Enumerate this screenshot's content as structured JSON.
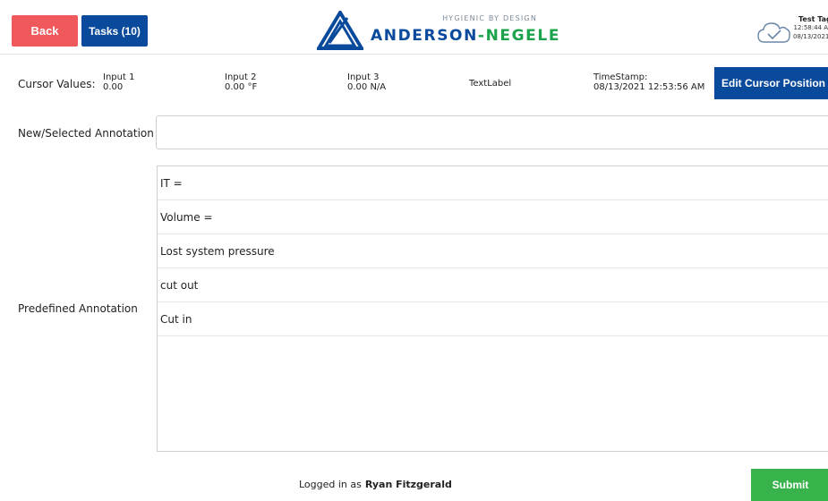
{
  "header": {
    "back_label": "Back",
    "tasks_label": "Tasks (10)",
    "logo_tagline": "HYGIENIC BY DESIGN",
    "logo_name_part1": "ANDERSON",
    "logo_name_sep": "-",
    "logo_name_part2": "NEGELE",
    "tag": {
      "title": "Test Tag",
      "time": "12:58:44 A",
      "date": "08/13/2021"
    }
  },
  "cursor": {
    "label": "Cursor Values:",
    "inputs": [
      {
        "name": "Input 1",
        "value": "0.00"
      },
      {
        "name": "Input 2",
        "value": "0.00 °F"
      },
      {
        "name": "Input 3",
        "value": "0.00 N/A"
      }
    ],
    "text_label": "TextLabel",
    "timestamp_label": "TimeStamp:",
    "timestamp_value": "08/13/2021 12:53:56 AM",
    "edit_button": "Edit Cursor Position"
  },
  "new_annotation": {
    "label": "New/Selected Annotation",
    "value": ""
  },
  "predefined": {
    "label": "Predefined Annotation",
    "items": [
      "IT =",
      "Volume =",
      "Lost system pressure",
      "cut out",
      "Cut in"
    ]
  },
  "footer": {
    "logged_prefix": "Logged in as",
    "user": "Ryan Fitzgerald",
    "submit_label": "Submit"
  },
  "colors": {
    "back": "#f0595c",
    "primary": "#0a4a9c",
    "submit": "#38b24a",
    "logo_green": "#1aa34a"
  }
}
